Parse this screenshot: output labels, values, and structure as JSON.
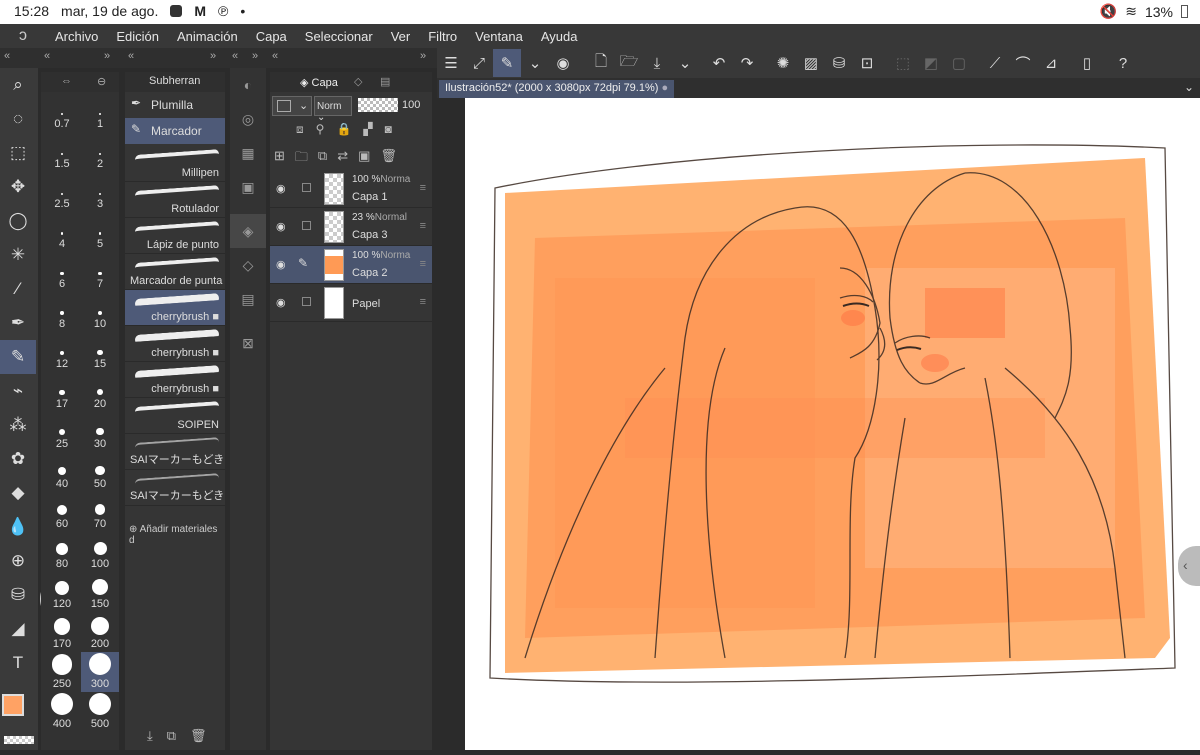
{
  "status_bar": {
    "time": "15:28",
    "date": "mar, 19 de ago.",
    "dot": "•",
    "battery": "13%"
  },
  "menu": [
    "Archivo",
    "Edición",
    "Animación",
    "Capa",
    "Seleccionar",
    "Ver",
    "Filtro",
    "Ventana",
    "Ayuda"
  ],
  "brush_sizes": {
    "left": [
      "0.7",
      "1.5",
      "2.5",
      "4",
      "6",
      "8",
      "12",
      "17",
      "25",
      "40",
      "60",
      "80",
      "120",
      "170",
      "250",
      "400"
    ],
    "right": [
      "1",
      "2",
      "3",
      "5",
      "7",
      "10",
      "15",
      "20",
      "30",
      "50",
      "70",
      "100",
      "150",
      "200",
      "300",
      "500"
    ],
    "selected": "300"
  },
  "subtool": {
    "header": "Subherran",
    "groups": [
      "Plumilla",
      "Marcador"
    ],
    "selected_group": "Marcador",
    "brushes": [
      "Millipen",
      "Rotulador",
      "Lápiz de punto",
      "Marcador de punta",
      "cherrybrush ■",
      "cherrybrush ■",
      "cherrybrush ■",
      "SOIPEN",
      "SAIマーカーもどき",
      "SAIマーカーもどき"
    ],
    "selected_brush": "cherrybrush ■",
    "add_label": "Añadir materiales d"
  },
  "layers_panel": {
    "title": "Capa",
    "blend_mode": "Norm",
    "opacity": "100",
    "layers": [
      {
        "opacity": "100 %",
        "mode": "Norma",
        "name": "Capa 1",
        "visible": true,
        "selected": false
      },
      {
        "opacity": "23 %",
        "mode": "Normal",
        "name": "Capa 3",
        "visible": true,
        "selected": false
      },
      {
        "opacity": "100 %",
        "mode": "Norma",
        "name": "Capa 2",
        "visible": true,
        "selected": true
      },
      {
        "opacity": "",
        "mode": "",
        "name": "Papel",
        "visible": true,
        "selected": false
      }
    ]
  },
  "document": {
    "tab_title": "Ilustración52* (2000 x 3080px 72dpi 79.1%)"
  },
  "colors": {
    "main": "#ffa264",
    "sub": "#1e1e1e",
    "accent": "#4e5a78",
    "canvas_orange": "#ff9a55"
  }
}
